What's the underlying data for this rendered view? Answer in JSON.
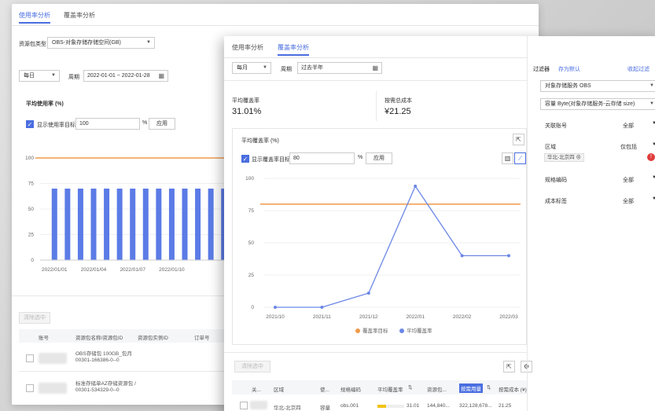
{
  "back": {
    "tabs": [
      "使用率分析",
      "覆盖率分析"
    ],
    "resource_type_label": "资源包类型",
    "resource_type_value": "OBS-对象存储存储空间(GB)",
    "period_select": "每日",
    "period_label": "周期",
    "date_range": "2022-01-01 ~ 2022-01-28",
    "avg_usage_label": "平均使用率 (%)",
    "show_target_label": "显示使用率目标",
    "target_value": "100",
    "percent_unit": "%",
    "apply_label": "应用",
    "clear_filter_label": "清除选中",
    "table_headers": [
      "账号",
      "资源包名称/资源包ID",
      "资源包实例ID",
      "订单号"
    ],
    "rows": [
      {
        "name": "OBS存储包 100GB_包月",
        "id": "00301-166386-0--0"
      },
      {
        "name": "标准存储单AZ存储资源包 /",
        "id": "00301-534329-0--0"
      }
    ]
  },
  "front": {
    "tabs": [
      "使用率分析",
      "覆盖率分析"
    ],
    "period_select": "每月",
    "period_label": "周期",
    "period_value": "过去半年",
    "avg_coverage_title": "平均覆盖率",
    "avg_coverage_value": "31.01%",
    "ondemand_cost_title": "按需总成本",
    "ondemand_cost_value": "¥21.25",
    "chart_box_title": "平均覆盖率 (%)",
    "show_target_label": "显示覆盖率目标",
    "target_value": "80",
    "percent_unit": "%",
    "apply_label": "应用",
    "clear_filter_label": "清除选中",
    "table_headers": {
      "c1": "关...",
      "c2": "区域",
      "c3": "使...",
      "c4": "规格编码",
      "c5": "平均覆盖率",
      "c6": "资源包...",
      "c7": "按需用量",
      "c8": "按需成本 (¥)"
    },
    "row": {
      "region": "华北-北京四",
      "usage_type": "容量",
      "spec": "obs.001",
      "coverage": "31.01",
      "resource": "144,840...",
      "ondemand": "322,128,678...",
      "cost": "21.25"
    }
  },
  "filter": {
    "title": "过滤器",
    "save_default": "存为默认",
    "collapse": "收起过滤",
    "service": "对象存储服务 OBS",
    "usage_type": "容量 Byte(对象存储服务-云存储 size)",
    "rows": [
      {
        "label": "关联账号",
        "value": "全部"
      },
      {
        "label": "区域",
        "value": "仅包括"
      },
      {
        "label": "规格编码",
        "value": "全部"
      },
      {
        "label": "成本标签",
        "value": "全部"
      }
    ],
    "region_tag": "华北-北京四",
    "badge": "!"
  },
  "chart_data": [
    {
      "type": "bar",
      "title": "平均使用率 (%)",
      "x_tick_labels": [
        "2022/01/01",
        "2022/01/04",
        "2022/01/07",
        "2022/01/10"
      ],
      "categories": [
        "2022/01/01",
        "2022/01/02",
        "2022/01/03",
        "2022/01/04",
        "2022/01/05",
        "2022/01/06",
        "2022/01/07",
        "2022/01/08",
        "2022/01/09",
        "2022/01/10",
        "2022/01/11",
        "2022/01/12",
        "2022/01/13",
        "2022/01/14"
      ],
      "values": [
        70,
        70,
        70,
        70,
        70,
        70,
        70,
        70,
        70,
        70,
        70,
        70,
        70,
        70
      ],
      "target": 100,
      "yticks": [
        0,
        25,
        50,
        75,
        100
      ],
      "ylim": [
        0,
        110
      ],
      "colors": {
        "bar": "#5b7be6",
        "target": "#f09a4a"
      }
    },
    {
      "type": "line",
      "title": "平均覆盖率 (%)",
      "categories": [
        "2021/10",
        "2021/11",
        "2021/12",
        "2022/01",
        "2022/02",
        "2022/03"
      ],
      "series": [
        {
          "name": "覆盖率目标",
          "values": [
            80,
            80,
            80,
            80,
            80,
            80
          ],
          "color": "#f09a4a"
        },
        {
          "name": "平均覆盖率",
          "values": [
            0,
            0,
            11,
            94,
            40,
            40
          ],
          "color": "#6b87e6"
        }
      ],
      "yticks": [
        0,
        25,
        50,
        75,
        100
      ],
      "ylim": [
        0,
        100
      ]
    }
  ]
}
